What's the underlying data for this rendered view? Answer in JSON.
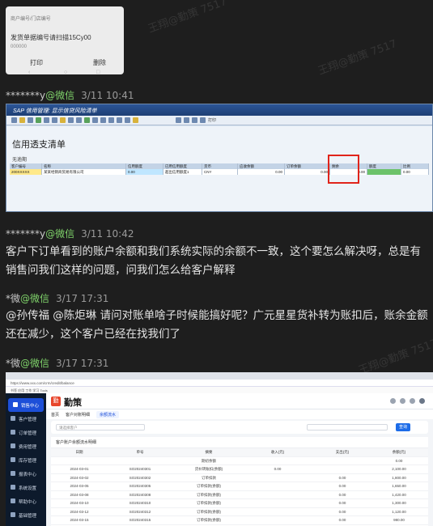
{
  "watermark": "王翔@勤策 7517",
  "phone_card": {
    "line1": "商户编号/门店编号",
    "line2": "发货单据编号请扫描15Cy00",
    "line3": "000000",
    "print_button": "打印",
    "delete_button": "删除",
    "nav_icons": [
      "‹",
      "○",
      "□"
    ]
  },
  "messages": [
    {
      "sender": "*******y",
      "channel": "@微信",
      "time": "3/11 10:41"
    },
    {
      "sender": "*******y",
      "channel": "@微信",
      "time": "3/11 10:42",
      "text": "客户下订单看到的账户余额和我们系统实际的余额不一致，这个要怎么解决呀，总是有销售问我们这样的问题，问我们怎么给客户解释"
    },
    {
      "sender": "*微",
      "channel": "@微信",
      "time": "3/17 17:31",
      "text": "@孙传福 @陈炬琳 请问对账单啥子时候能搞好呢？广元星星货补转为账扣后，账余金额还在减少，这个客户已经在找我们了"
    },
    {
      "sender": "*微",
      "channel": "@微信",
      "time": "3/17 17:31"
    }
  ],
  "sap": {
    "window_title": "SAP 信用管理: 显示信贷风险清单",
    "toolbar_label": "打印",
    "heading": "信用透支清单",
    "sub": "无逾期",
    "header": [
      "客户编号",
      "名称",
      "信用额度",
      "已用信用额度",
      "货币",
      "应收余额",
      "订单余额",
      "剩余",
      "额度",
      "比例"
    ],
    "row": [
      "200XXXXX",
      "某某经销商贸易有限公司",
      "0.00",
      "超出信用额度1",
      "CNY",
      "0.00",
      "0.00",
      "0.00",
      "",
      "0.00"
    ]
  },
  "browser": {
    "address": "https://www.xxx.com/crm/credit/balance",
    "bookmarks": "书签  应用  工作  学习  Tools",
    "brand_mark": "勤",
    "brand_name": "勤策",
    "sidebar": [
      "销售中心",
      "客户管理",
      "订单管理",
      "费用管理",
      "库存管理",
      "报表中心",
      "系统设置",
      "帮助中心",
      "基础管理"
    ],
    "tabs": [
      "首页",
      "客户对账明细",
      "余额流水"
    ],
    "filter_placeholder": "请选择客户",
    "query_button": "查询",
    "table_title": "客户账户余额流水明细",
    "columns": [
      "日期",
      "单号",
      "摘要",
      "收入(元)",
      "支出(元)",
      "余额(元)"
    ],
    "rows": [
      [
        "",
        "",
        "期初余额",
        "",
        "",
        "0.00"
      ],
      [
        "2024-03-01",
        "SO20240301",
        "货补转账扣(余额)",
        "0.00",
        "",
        "2,100.00"
      ],
      [
        "2024-03-02",
        "SO20240302",
        "订单扣款",
        "",
        "0.00",
        "1,800.00"
      ],
      [
        "2024-03-05",
        "SO20240305",
        "订单扣款(余额)",
        "",
        "0.00",
        "1,650.00"
      ],
      [
        "2024-03-08",
        "SO20240308",
        "订单扣款(余额)",
        "",
        "0.00",
        "1,420.00"
      ],
      [
        "2024-03-10",
        "SO20240310",
        "订单扣款(余额)",
        "",
        "0.00",
        "1,300.00"
      ],
      [
        "2024-03-12",
        "SO20240312",
        "订单扣款(余额)",
        "",
        "0.00",
        "1,120.00"
      ],
      [
        "2024-03-15",
        "SO20240315",
        "订单扣款(余额)",
        "",
        "0.00",
        "980.00"
      ]
    ]
  }
}
